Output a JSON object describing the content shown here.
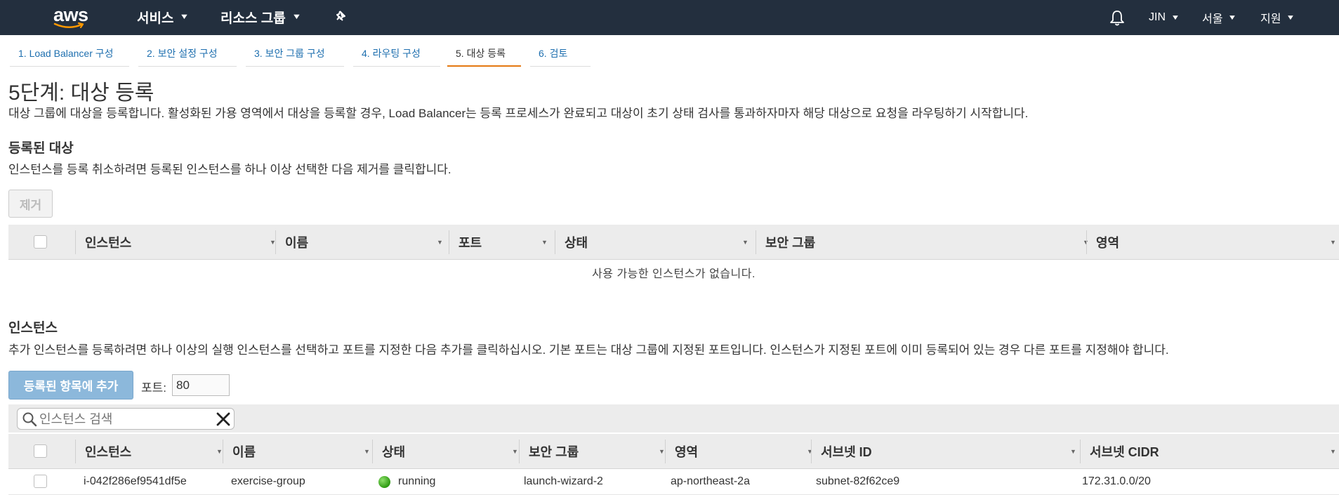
{
  "nav": {
    "logo": "aws",
    "services": "서비스",
    "resource_groups": "리소스 그룹",
    "user": "JIN",
    "region": "서울",
    "support": "지원"
  },
  "wizard_tabs": [
    "1. Load Balancer 구성",
    "2. 보안 설정 구성",
    "3. 보안 그룹 구성",
    "4. 라우팅 구성",
    "5. 대상 등록",
    "6. 검토"
  ],
  "active_tab_index": 4,
  "page": {
    "title": "5단계: 대상 등록",
    "description": "대상 그룹에 대상을 등록합니다. 활성화된 가용 영역에서 대상을 등록할 경우, Load Balancer는 등록 프로세스가 완료되고 대상이 초기 상태 검사를 통과하자마자 해당 대상으로 요청을 라우팅하기 시작합니다."
  },
  "registered": {
    "heading": "등록된 대상",
    "description": "인스턴스를 등록 취소하려면 등록된 인스턴스를 하나 이상 선택한 다음 제거를 클릭합니다.",
    "remove_button": "제거",
    "columns": [
      "인스턴스",
      "이름",
      "포트",
      "상태",
      "보안 그룹",
      "영역"
    ],
    "empty_message": "사용 가능한 인스턴스가 없습니다."
  },
  "instances": {
    "heading": "인스턴스",
    "description": "추가 인스턴스를 등록하려면 하나 이상의 실행 인스턴스를 선택하고 포트를 지정한 다음 추가를 클릭하십시오. 기본 포트는 대상 그룹에 지정된 포트입니다. 인스턴스가 지정된 포트에 이미 등록되어 있는 경우 다른 포트를 지정해야 합니다.",
    "add_button": "등록된 항목에 추가",
    "port_label": "포트:",
    "port_value": "80",
    "search_placeholder": "인스턴스 검색",
    "columns": [
      "인스턴스",
      "이름",
      "상태",
      "보안 그룹",
      "영역",
      "서브넷 ID",
      "서브넷 CIDR"
    ],
    "rows": [
      {
        "instance": "i-042f286ef9541df5e",
        "name": "exercise-group",
        "state": "running",
        "security_group": "launch-wizard-2",
        "zone": "ap-northeast-2a",
        "subnet_id": "subnet-82f62ce9",
        "subnet_cidr": "172.31.0.0/20"
      }
    ]
  },
  "colors": {
    "nav_bg": "#232f3e",
    "link": "#1e6faf",
    "active_tab_underline": "#e47911",
    "primary_button_disabled": "#8cb8db",
    "running": "#2e9a12"
  }
}
